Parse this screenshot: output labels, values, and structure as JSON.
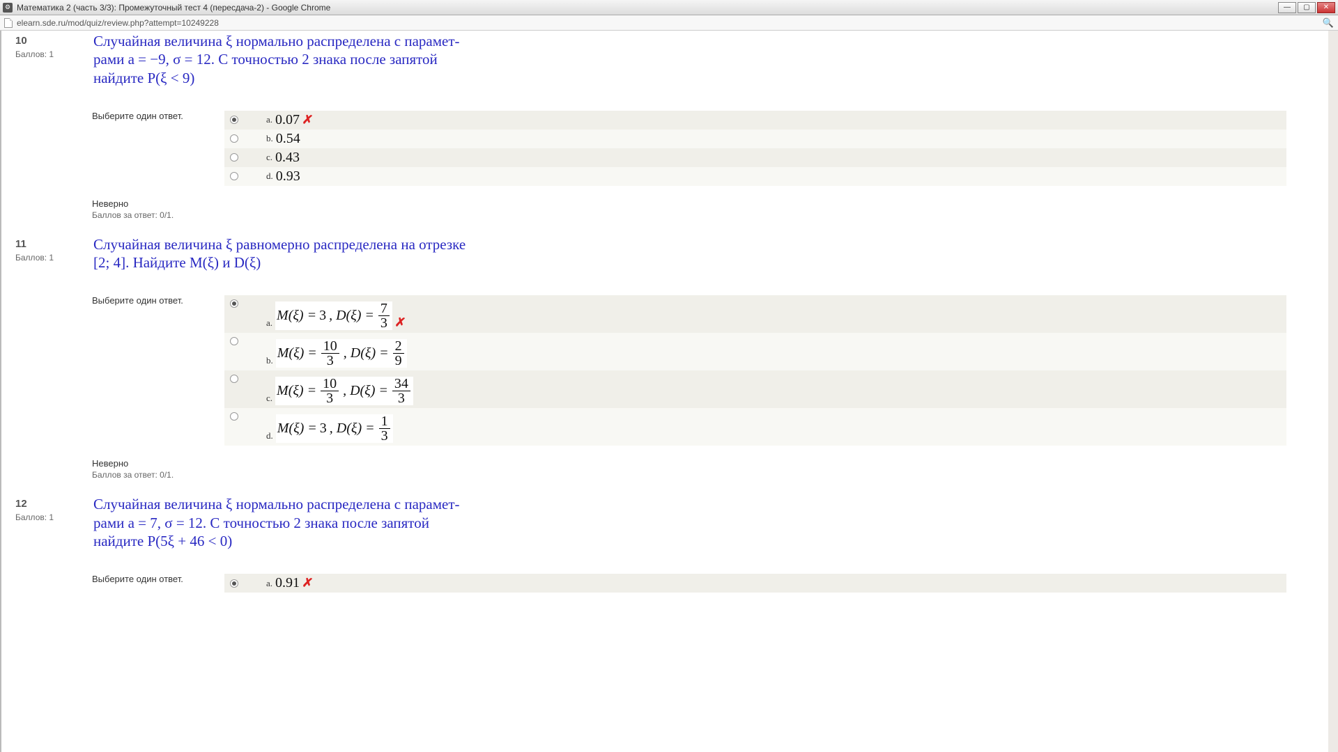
{
  "window": {
    "title": "Математика 2 (часть 3/3): Промежуточный тест 4 (пересдача-2) - Google Chrome",
    "url": "elearn.sde.ru/mod/quiz/review.php?attempt=10249228"
  },
  "prompt_label": "Выберите один ответ.",
  "points_label": "Баллов: 1",
  "feedback_status": "Неверно",
  "feedback_grade": "Баллов за ответ: 0/1.",
  "wrong_mark": "✗",
  "questions": [
    {
      "num": "10",
      "text_lines": [
        "Случайная величина ξ нормально распределена с парамет-",
        "рами a = −9, σ = 12. С точностью 2 знака после запятой",
        "найдите P(ξ < 9)"
      ],
      "options": [
        {
          "letter": "a.",
          "value": "0.07",
          "selected": true,
          "wrong": true
        },
        {
          "letter": "b.",
          "value": "0.54"
        },
        {
          "letter": "c.",
          "value": "0.43"
        },
        {
          "letter": "d.",
          "value": "0.93"
        }
      ]
    },
    {
      "num": "11",
      "text_lines": [
        "Случайная величина ξ равномерно распределена на отрезке",
        "[2; 4]. Найдите M(ξ) и D(ξ)"
      ],
      "options": [
        {
          "letter": "a.",
          "formula": {
            "m": "3",
            "d_num": "7",
            "d_den": "3"
          },
          "selected": true,
          "wrong": true
        },
        {
          "letter": "b.",
          "formula": {
            "m_num": "10",
            "m_den": "3",
            "d_num": "2",
            "d_den": "9"
          }
        },
        {
          "letter": "c.",
          "formula": {
            "m_num": "10",
            "m_den": "3",
            "d_num": "34",
            "d_den": "3"
          }
        },
        {
          "letter": "d.",
          "formula": {
            "m": "3",
            "d_num": "1",
            "d_den": "3"
          }
        }
      ]
    },
    {
      "num": "12",
      "text_lines": [
        "Случайная величина ξ нормально распределена с парамет-",
        "рами a = 7, σ = 12. С точностью 2 знака после запятой",
        "найдите P(5ξ + 46 < 0)"
      ],
      "options": [
        {
          "letter": "a.",
          "value": "0.91",
          "selected": true,
          "wrong": true
        }
      ]
    }
  ]
}
